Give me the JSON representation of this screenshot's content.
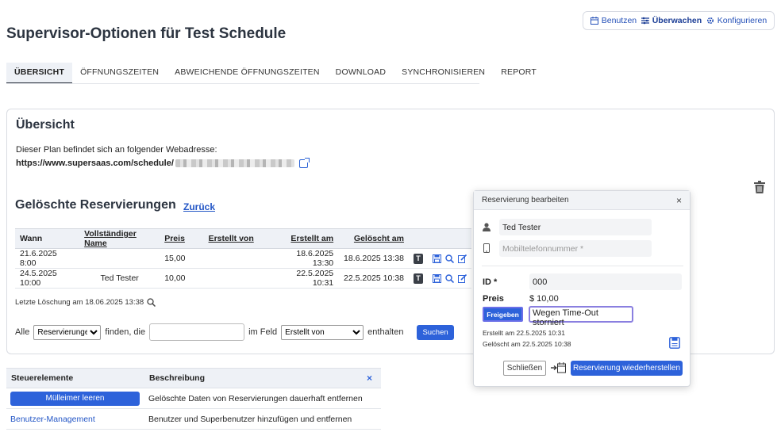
{
  "topnav": {
    "items": [
      {
        "label": "Benutzen",
        "icon": "calendar-icon"
      },
      {
        "label": "Überwachen",
        "icon": "sliders-icon"
      },
      {
        "label": "Konfigurieren",
        "icon": "gear-icon"
      }
    ]
  },
  "page": {
    "title": "Supervisor-Optionen für Test Schedule"
  },
  "tabs": [
    {
      "label": "ÜBERSICHT"
    },
    {
      "label": "ÖFFNUNGSZEITEN"
    },
    {
      "label": "ABWEICHENDE ÖFFNUNGSZEITEN"
    },
    {
      "label": "DOWNLOAD"
    },
    {
      "label": "SYNCHRONISIEREN"
    },
    {
      "label": "REPORT"
    }
  ],
  "overview": {
    "title": "Übersicht",
    "intro": "Dieser Plan befindet sich an folgender Webadresse:",
    "url_prefix": "https://www.supersaas.com/schedule/"
  },
  "deleted": {
    "title": "Gelöschte Reservierungen",
    "back_label": "Zurück",
    "columns": [
      "Wann",
      "Vollständiger Name",
      "Preis",
      "Erstellt von",
      "Erstellt am",
      "Gelöscht am"
    ],
    "rows": [
      {
        "when": "21.6.2025 8:00",
        "name": "",
        "price": "15,00",
        "created_by": "",
        "created_at": "18.6.2025 13:30",
        "deleted_at": "18.6.2025 13:38",
        "badge": "T"
      },
      {
        "when": "24.5.2025 10:00",
        "name": "Ted Tester",
        "price": "10,00",
        "created_by": "",
        "created_at": "22.5.2025 10:31",
        "deleted_at": "22.5.2025 10:38",
        "badge": "T"
      }
    ],
    "last_deletion": "Letzte Löschung am 18.06.2025 13:38"
  },
  "search": {
    "prefix": "Alle",
    "scope_selected": "Reservierungen",
    "middle": "finden, die",
    "query_value": "",
    "field_prefix": "im Feld",
    "field_selected": "Erstellt von",
    "suffix": "enthalten",
    "button_label": "Suchen"
  },
  "controls": {
    "col_controls": "Steuerelemente",
    "col_description": "Beschreibung",
    "close_label": "×",
    "rows": [
      {
        "control": "Mülleimer leeren",
        "description": "Gelöschte Daten von Reservierungen dauerhaft entfernen"
      },
      {
        "control": "Benutzer-Management",
        "description": "Benutzer und Superbenutzer hinzufügen und entfernen"
      }
    ]
  },
  "modal": {
    "title": "Reservierung bearbeiten",
    "close_label": "×",
    "name_value": "Ted Tester",
    "phone_placeholder": "Mobiltelefonnummer *",
    "id_label": "ID *",
    "id_value": "000",
    "price_label": "Preis",
    "price_value": "$ 10,00",
    "release_label": "Freigeben",
    "status_value": "Wegen Time-Out storniert",
    "created_text": "Erstellt am 22.5.2025 10:31",
    "deleted_text": "Gelöscht am 22.5.2025 10:38",
    "close_button": "Schließen",
    "restore_button": "Reservierung wiederherstellen"
  },
  "colors": {
    "accent": "#2d62da",
    "link": "#2356c6",
    "heading": "#2c3440"
  }
}
